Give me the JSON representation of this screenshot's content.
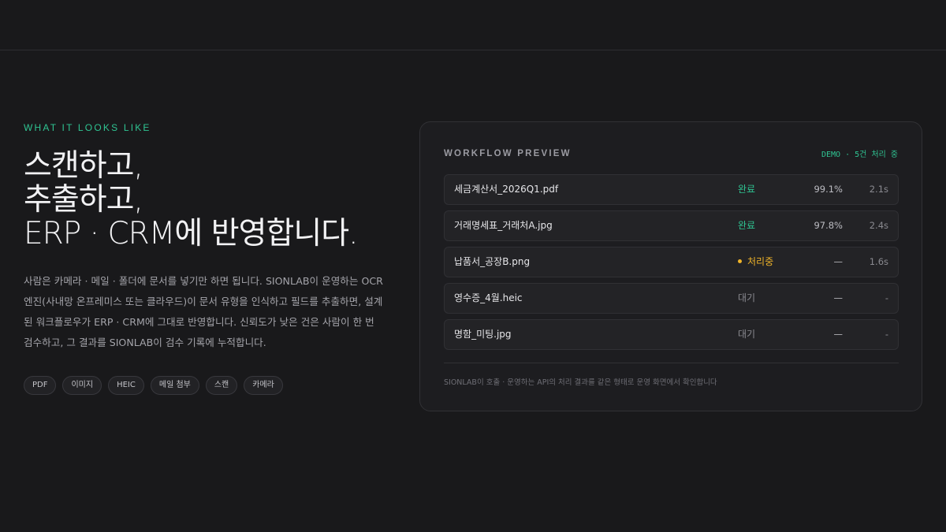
{
  "section": {
    "eyebrow": "WHAT IT LOOKS LIKE",
    "headline": [
      "스캔하고,",
      "추출하고,",
      "ERP · CRM에 반영합니다."
    ],
    "description": "사람은 카메라 · 메일 · 폴더에 문서를 넣기만 하면 됩니다. SIONLAB이 운영하는 OCR 엔진(사내망 온프레미스 또는 클라우드)이 문서 유형을 인식하고 필드를 추출하면, 설계된 워크플로우가 ERP · CRM에 그대로 반영합니다. 신뢰도가 낮은 건은 사람이 한 번 검수하고, 그 결과를 SIONLAB이 검수 기록에 누적합니다.",
    "tags": [
      "PDF",
      "이미지",
      "HEIC",
      "메일 첨부",
      "스캔",
      "카메라"
    ]
  },
  "preview": {
    "title": "WORKFLOW PREVIEW",
    "status": "DEMO · 5건 처리 중",
    "rows": [
      {
        "name": "세금계산서_2026Q1.pdf",
        "status": "완료",
        "state": "done",
        "confidence": "99.1%",
        "time": "2.1s"
      },
      {
        "name": "거래명세표_거래처A.jpg",
        "status": "완료",
        "state": "done",
        "confidence": "97.8%",
        "time": "2.4s"
      },
      {
        "name": "납품서_공장B.png",
        "status": "처리중",
        "state": "proc",
        "confidence": "—",
        "time": "1.6s"
      },
      {
        "name": "영수증_4월.heic",
        "status": "대기",
        "state": "wait",
        "confidence": "—",
        "time": "-"
      },
      {
        "name": "명함_미팅.jpg",
        "status": "대기",
        "state": "wait",
        "confidence": "—",
        "time": "-"
      }
    ],
    "footnote": "SIONLAB이 호출 · 운영하는 API의 처리 결과를 같은 형태로 운영 화면에서 확인합니다"
  },
  "colors": {
    "accent": "#2fc492",
    "processing": "#f0b429",
    "background": "#19191b"
  }
}
